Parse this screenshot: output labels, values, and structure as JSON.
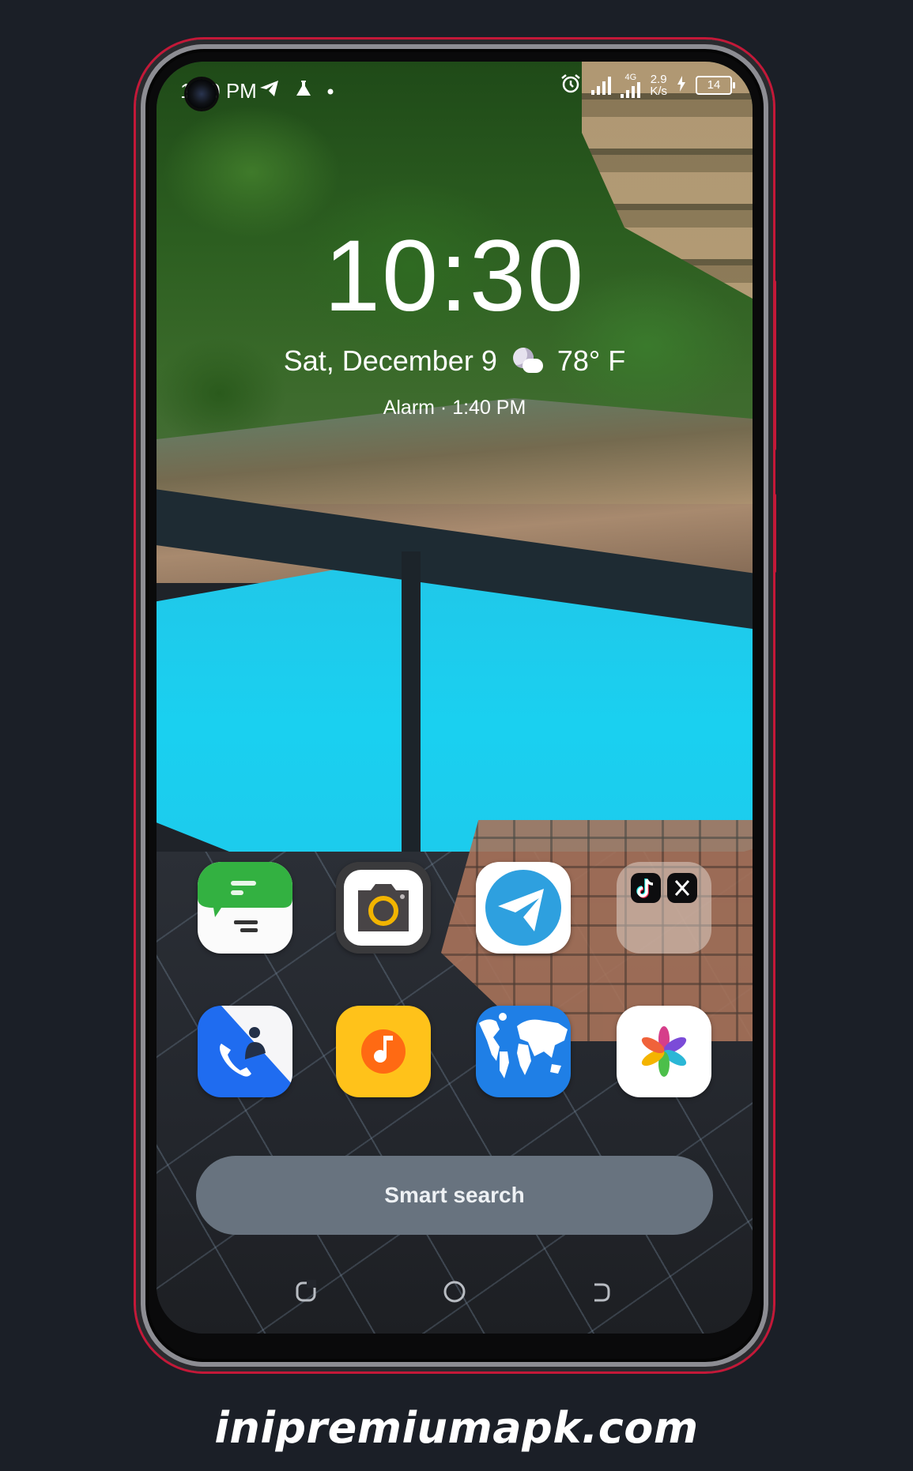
{
  "status_bar": {
    "time": "1:30 PM",
    "left_icons": [
      "telegram-icon",
      "flask-icon",
      "dot-icon"
    ],
    "network_type": "4G",
    "speed_value": "2.9",
    "speed_unit": "K/s",
    "battery_level": "14",
    "charging": true
  },
  "lockscreen": {
    "clock": "10:30",
    "date": "Sat, December 9",
    "weather_icon": "moon-cloud-icon",
    "temperature": "78° F",
    "alarm": "Alarm · 1:40 PM"
  },
  "apps": {
    "row1": [
      {
        "name": "Messages",
        "icon": "messages-icon",
        "color": "#2fae3e"
      },
      {
        "name": "Camera",
        "icon": "camera-icon",
        "color": "#f2b400"
      },
      {
        "name": "Telegram",
        "icon": "telegram-icon",
        "color": "#2ea0df"
      },
      {
        "name": "Folder",
        "icon": "folder-icon",
        "apps": [
          "TikTok",
          "X"
        ]
      }
    ],
    "row2": [
      {
        "name": "Phone",
        "icon": "phone-icon",
        "color": "#1f6cf0"
      },
      {
        "name": "Music",
        "icon": "music-icon",
        "color": "#ffc21a"
      },
      {
        "name": "Browser",
        "icon": "globe-icon",
        "color": "#1f7fe6"
      },
      {
        "name": "Photos",
        "icon": "photos-icon",
        "color": "#ffffff"
      }
    ]
  },
  "search": {
    "label": "Smart search"
  },
  "nav": [
    "recents",
    "home",
    "back"
  ],
  "watermark": "inipremiumapk.com",
  "colors": {
    "frame_accent": "#c41838",
    "background": "#1b1f27",
    "search_bg": "#68737f"
  }
}
